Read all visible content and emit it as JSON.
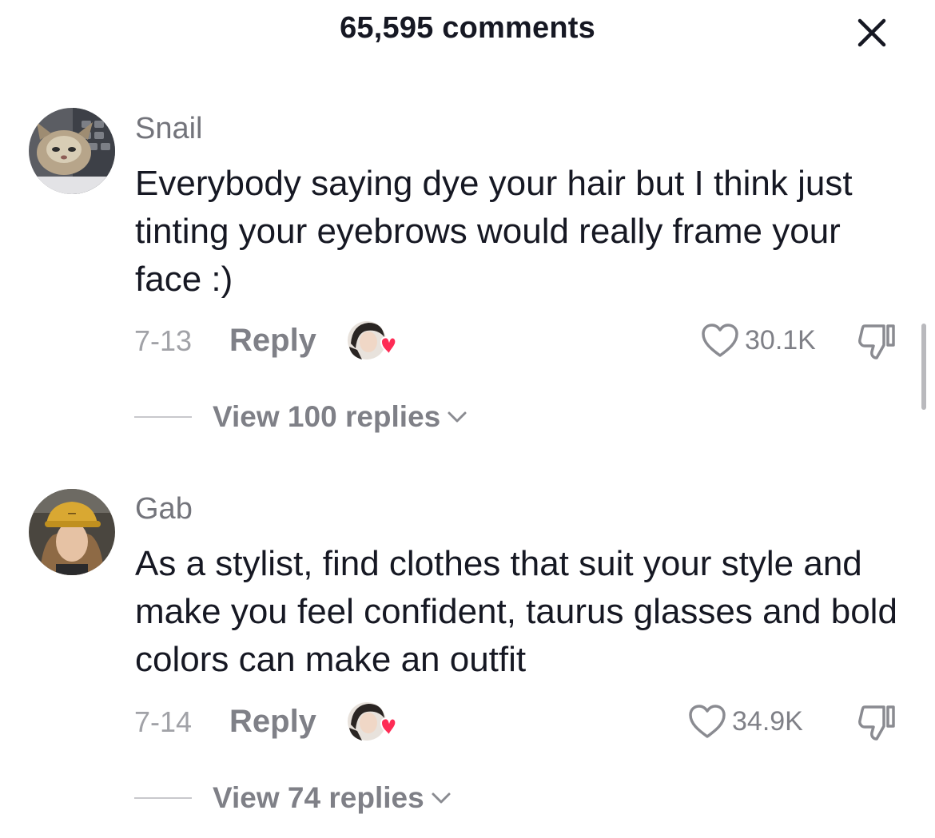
{
  "header": {
    "title": "65,595 comments"
  },
  "colors": {
    "text": "#161823",
    "muted": "#7f8087",
    "date": "#a1a2a7",
    "heart": "#fe2c55"
  },
  "comments": [
    {
      "username": "Snail",
      "text": "Everybody saying dye your hair but I think just tinting your eyebrows would really frame your face :)",
      "date": "7-13",
      "reply_label": "Reply",
      "likes": "30.1K",
      "view_replies": "View 100 replies"
    },
    {
      "username": "Gab",
      "text": "As a stylist, find clothes that suit your style and make you feel confident, taurus glasses and bold colors can make an outfit",
      "date": "7-14",
      "reply_label": "Reply",
      "likes": "34.9K",
      "view_replies": "View 74 replies"
    }
  ]
}
